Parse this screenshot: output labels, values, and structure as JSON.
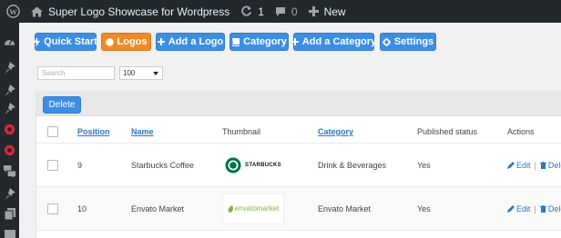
{
  "admin_bar": {
    "site_name": "Super Logo Showcase for Wordpress",
    "updates_count": "1",
    "comments_count": "0",
    "new_label": "New"
  },
  "toolbar": {
    "quick_start": "Quick Start",
    "logos": "Logos",
    "add_logo": "Add a Logo",
    "category": "Category",
    "add_category": "Add a Category",
    "settings": "Settings"
  },
  "filters": {
    "search_placeholder": "Search",
    "per_page": "100"
  },
  "table": {
    "delete_label": "Delete",
    "headers": {
      "position": "Position",
      "name": "Name",
      "thumbnail": "Thumbnail",
      "category": "Category",
      "published_status": "Published status",
      "actions": "Actions"
    },
    "rows": [
      {
        "position": "9",
        "name": "Starbucks Coffee",
        "thumbnail_text": "STARBUCKS",
        "category": "Drink & Beverages",
        "published": "Yes",
        "edit": "Edit",
        "delete": "Delete"
      },
      {
        "position": "10",
        "name": "Envato Market",
        "thumbnail_text": "envatomarket",
        "category": "Envato Market",
        "published": "Yes",
        "edit": "Edit",
        "delete": "Delete"
      }
    ]
  },
  "colors": {
    "admin_bar_bg": "#23282d",
    "button_blue": "#3c8ee5",
    "button_orange": "#f08a24",
    "link_blue": "#2a75c4",
    "starbucks_green": "#00704a",
    "envato_green": "#82b540"
  },
  "icons": {
    "admin_bar": [
      "wordpress-logo-icon",
      "home-icon",
      "refresh-icon",
      "comment-icon",
      "plus-icon"
    ],
    "sidebar": [
      "dashboard-icon",
      "pin-icon",
      "pin-icon",
      "pin-icon",
      "lifebuoy-icon",
      "lifebuoy-icon",
      "comments-icon",
      "pin-icon",
      "pages-icon",
      "media-icon"
    ]
  }
}
